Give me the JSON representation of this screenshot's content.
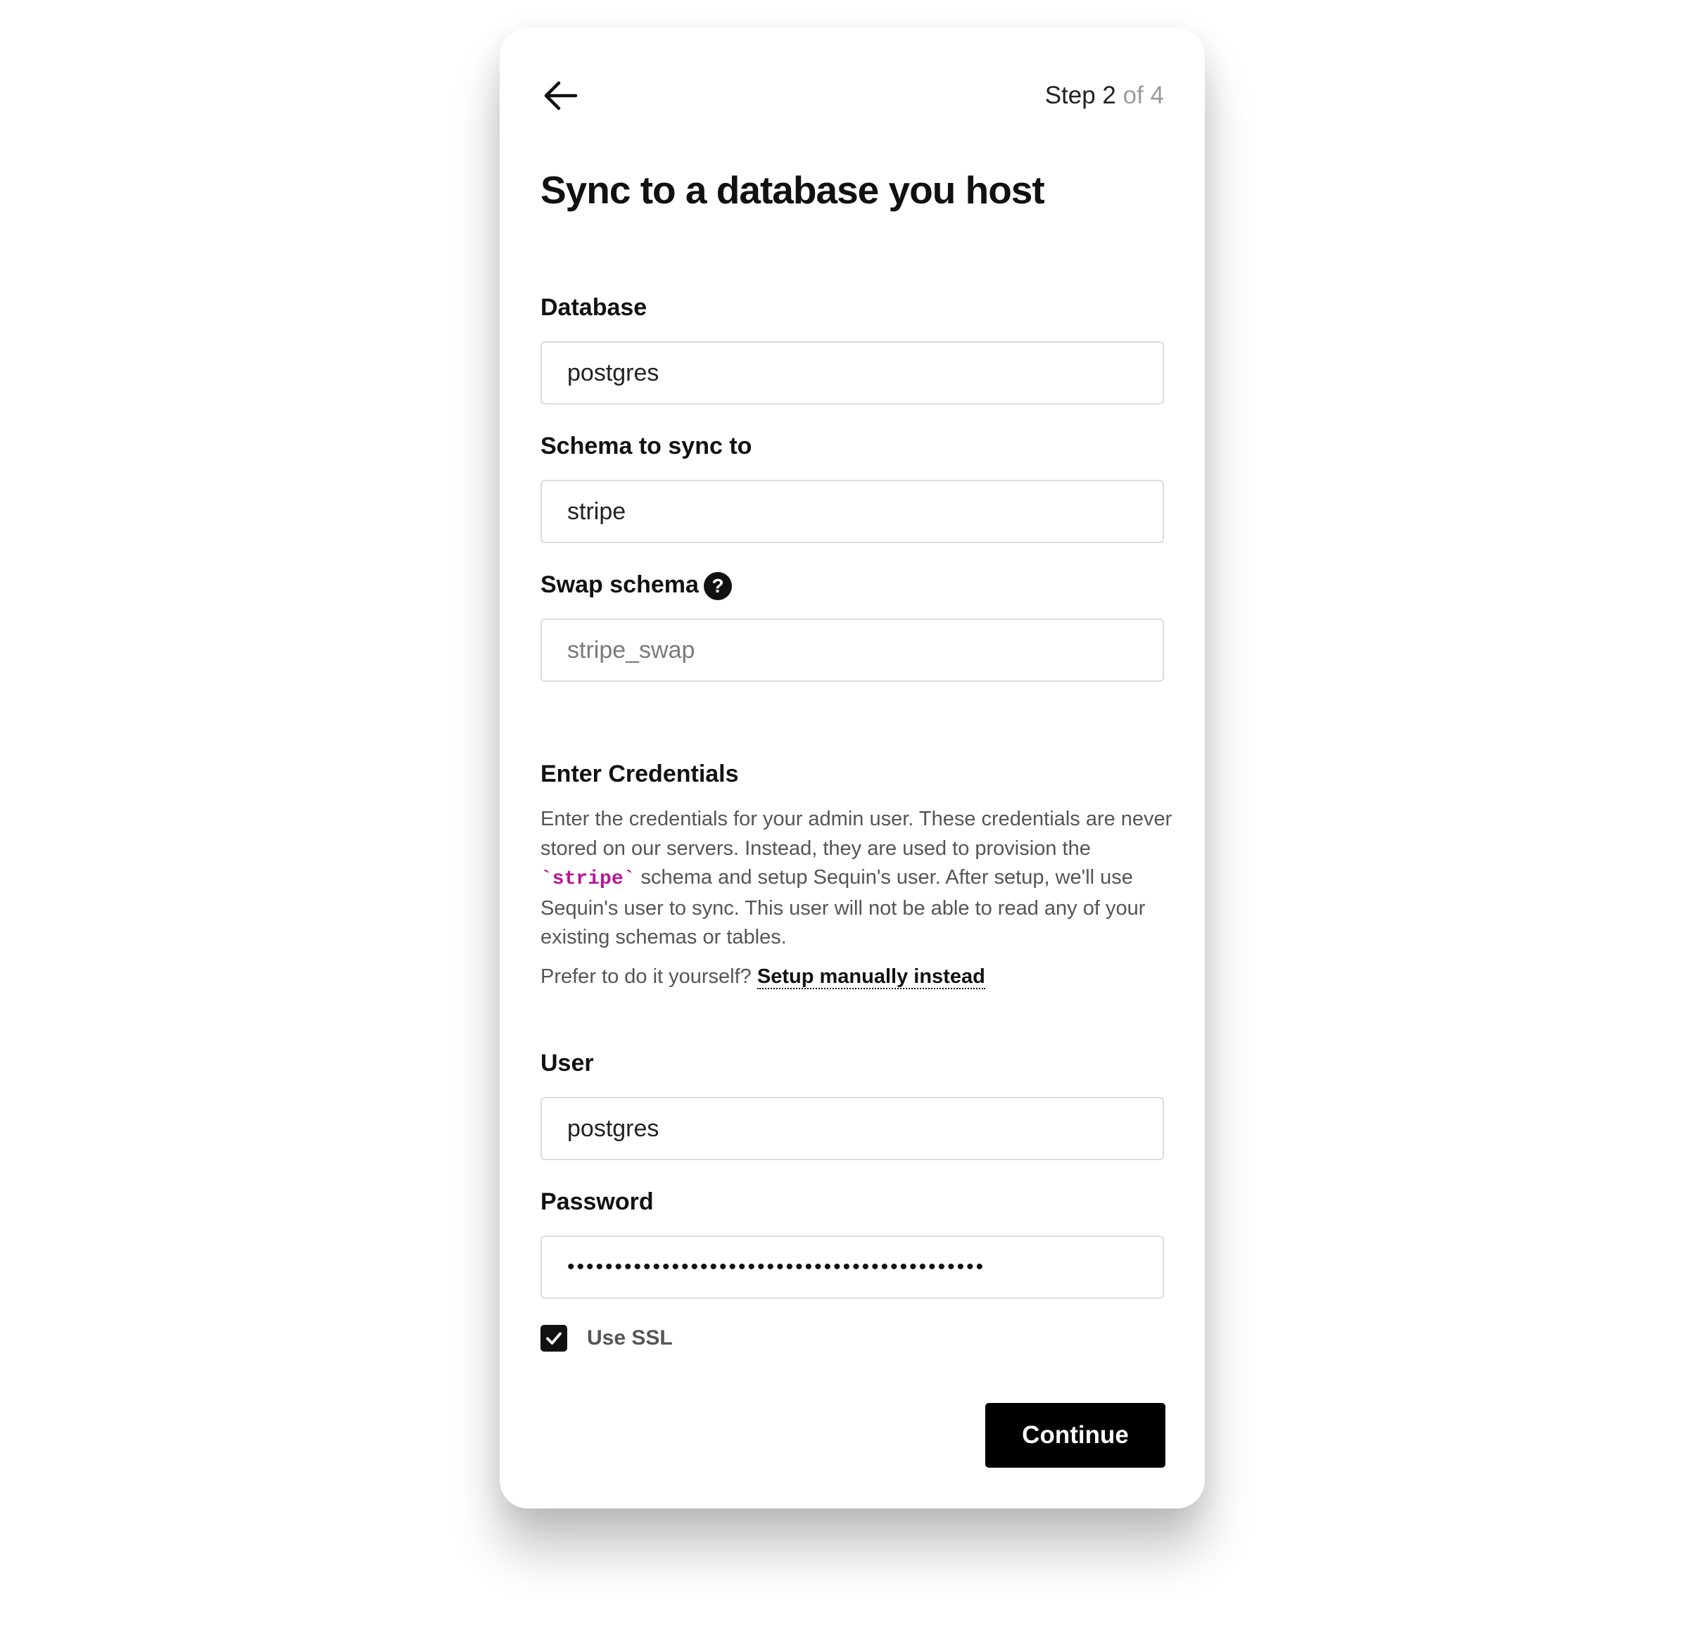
{
  "header": {
    "step_current": "Step 2",
    "step_total": " of 4"
  },
  "page": {
    "title": "Sync to a database you host"
  },
  "database": {
    "label": "Database",
    "value": "postgres"
  },
  "schema": {
    "label": "Schema to sync to",
    "value": "stripe"
  },
  "swap_schema": {
    "label": "Swap schema",
    "help_glyph": "?",
    "placeholder": "stripe_swap"
  },
  "credentials": {
    "title": "Enter Credentials",
    "description_before": "Enter the credentials for your admin user. These credentials are never stored on our servers. Instead, they are used to provision the ",
    "code": "`stripe`",
    "description_after": " schema and setup Sequin's user. After setup, we'll use Sequin's user to sync. This user will not be able to read any of your existing schemas or tables.",
    "prefer_text": "Prefer to do it yourself? ",
    "manual_link": "Setup manually instead"
  },
  "user": {
    "label": "User",
    "value": "postgres"
  },
  "password": {
    "label": "Password",
    "value": "••••••••••••••••••••••••••••••••••••••••••••"
  },
  "ssl": {
    "label": "Use SSL",
    "checked": true
  },
  "actions": {
    "continue_label": "Continue"
  },
  "colors": {
    "accent": "#000000",
    "code": "#b5169b",
    "muted": "#9b9b9b"
  }
}
